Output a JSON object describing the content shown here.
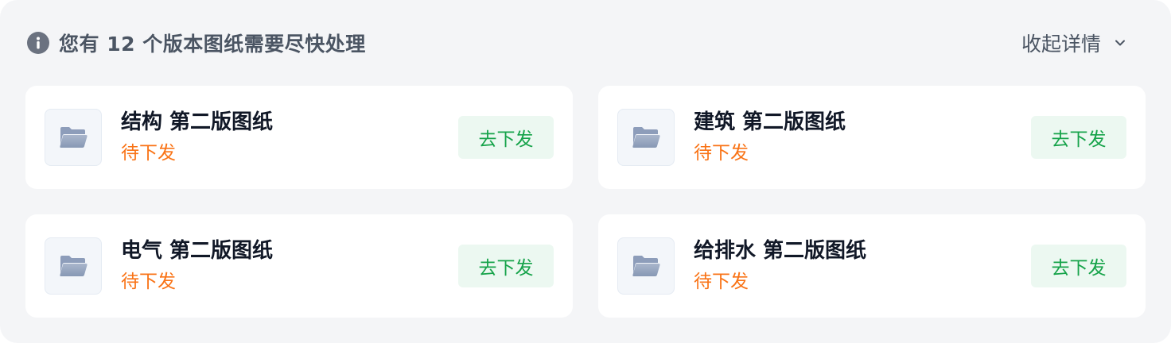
{
  "header": {
    "title": "您有 12 个版本图纸需要尽快处理",
    "toggle_label": "收起详情",
    "info_icon": "info-icon",
    "chevron_icon": "chevron-down-icon"
  },
  "colors": {
    "status": "#f97316",
    "action_text": "#16a34a",
    "action_bg": "#ecf8f1"
  },
  "cards": [
    {
      "title": "结构 第二版图纸",
      "status": "待下发",
      "action": "去下发",
      "icon": "folder-icon"
    },
    {
      "title": "建筑 第二版图纸",
      "status": "待下发",
      "action": "去下发",
      "icon": "folder-icon"
    },
    {
      "title": "电气 第二版图纸",
      "status": "待下发",
      "action": "去下发",
      "icon": "folder-icon"
    },
    {
      "title": "给排水 第二版图纸",
      "status": "待下发",
      "action": "去下发",
      "icon": "folder-icon"
    }
  ]
}
